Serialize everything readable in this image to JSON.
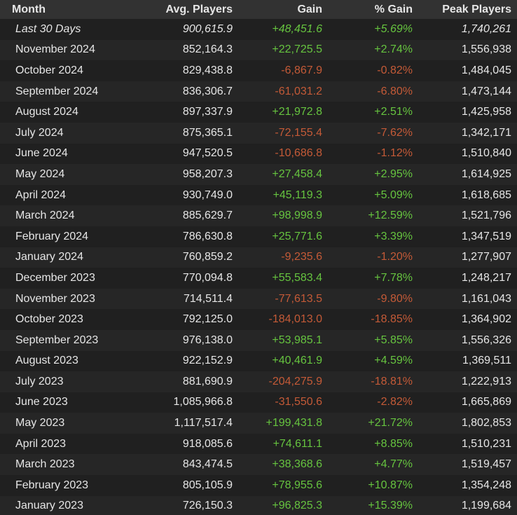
{
  "table": {
    "headers": [
      "Month",
      "Avg. Players",
      "Gain",
      "% Gain",
      "Peak Players"
    ],
    "colors": {
      "positive": "#66c43f",
      "negative": "#c45a37",
      "text": "#e6e6e6",
      "header_bg": "#323232"
    },
    "rows": [
      {
        "month": "Last 30 Days",
        "avg": "900,615.9",
        "gain": "+48,451.6",
        "pct": "+5.69%",
        "peak": "1,740,261",
        "trend": "pos",
        "italic": true
      },
      {
        "month": "November 2024",
        "avg": "852,164.3",
        "gain": "+22,725.5",
        "pct": "+2.74%",
        "peak": "1,556,938",
        "trend": "pos"
      },
      {
        "month": "October 2024",
        "avg": "829,438.8",
        "gain": "-6,867.9",
        "pct": "-0.82%",
        "peak": "1,484,045",
        "trend": "neg"
      },
      {
        "month": "September 2024",
        "avg": "836,306.7",
        "gain": "-61,031.2",
        "pct": "-6.80%",
        "peak": "1,473,144",
        "trend": "neg"
      },
      {
        "month": "August 2024",
        "avg": "897,337.9",
        "gain": "+21,972.8",
        "pct": "+2.51%",
        "peak": "1,425,958",
        "trend": "pos"
      },
      {
        "month": "July 2024",
        "avg": "875,365.1",
        "gain": "-72,155.4",
        "pct": "-7.62%",
        "peak": "1,342,171",
        "trend": "neg"
      },
      {
        "month": "June 2024",
        "avg": "947,520.5",
        "gain": "-10,686.8",
        "pct": "-1.12%",
        "peak": "1,510,840",
        "trend": "neg"
      },
      {
        "month": "May 2024",
        "avg": "958,207.3",
        "gain": "+27,458.4",
        "pct": "+2.95%",
        "peak": "1,614,925",
        "trend": "pos"
      },
      {
        "month": "April 2024",
        "avg": "930,749.0",
        "gain": "+45,119.3",
        "pct": "+5.09%",
        "peak": "1,618,685",
        "trend": "pos"
      },
      {
        "month": "March 2024",
        "avg": "885,629.7",
        "gain": "+98,998.9",
        "pct": "+12.59%",
        "peak": "1,521,796",
        "trend": "pos"
      },
      {
        "month": "February 2024",
        "avg": "786,630.8",
        "gain": "+25,771.6",
        "pct": "+3.39%",
        "peak": "1,347,519",
        "trend": "pos"
      },
      {
        "month": "January 2024",
        "avg": "760,859.2",
        "gain": "-9,235.6",
        "pct": "-1.20%",
        "peak": "1,277,907",
        "trend": "neg"
      },
      {
        "month": "December 2023",
        "avg": "770,094.8",
        "gain": "+55,583.4",
        "pct": "+7.78%",
        "peak": "1,248,217",
        "trend": "pos"
      },
      {
        "month": "November 2023",
        "avg": "714,511.4",
        "gain": "-77,613.5",
        "pct": "-9.80%",
        "peak": "1,161,043",
        "trend": "neg"
      },
      {
        "month": "October 2023",
        "avg": "792,125.0",
        "gain": "-184,013.0",
        "pct": "-18.85%",
        "peak": "1,364,902",
        "trend": "neg"
      },
      {
        "month": "September 2023",
        "avg": "976,138.0",
        "gain": "+53,985.1",
        "pct": "+5.85%",
        "peak": "1,556,326",
        "trend": "pos"
      },
      {
        "month": "August 2023",
        "avg": "922,152.9",
        "gain": "+40,461.9",
        "pct": "+4.59%",
        "peak": "1,369,511",
        "trend": "pos"
      },
      {
        "month": "July 2023",
        "avg": "881,690.9",
        "gain": "-204,275.9",
        "pct": "-18.81%",
        "peak": "1,222,913",
        "trend": "neg"
      },
      {
        "month": "June 2023",
        "avg": "1,085,966.8",
        "gain": "-31,550.6",
        "pct": "-2.82%",
        "peak": "1,665,869",
        "trend": "neg"
      },
      {
        "month": "May 2023",
        "avg": "1,117,517.4",
        "gain": "+199,431.8",
        "pct": "+21.72%",
        "peak": "1,802,853",
        "trend": "pos"
      },
      {
        "month": "April 2023",
        "avg": "918,085.6",
        "gain": "+74,611.1",
        "pct": "+8.85%",
        "peak": "1,510,231",
        "trend": "pos"
      },
      {
        "month": "March 2023",
        "avg": "843,474.5",
        "gain": "+38,368.6",
        "pct": "+4.77%",
        "peak": "1,519,457",
        "trend": "pos"
      },
      {
        "month": "February 2023",
        "avg": "805,105.9",
        "gain": "+78,955.6",
        "pct": "+10.87%",
        "peak": "1,354,248",
        "trend": "pos"
      },
      {
        "month": "January 2023",
        "avg": "726,150.3",
        "gain": "+96,825.3",
        "pct": "+15.39%",
        "peak": "1,199,684",
        "trend": "pos"
      }
    ]
  }
}
